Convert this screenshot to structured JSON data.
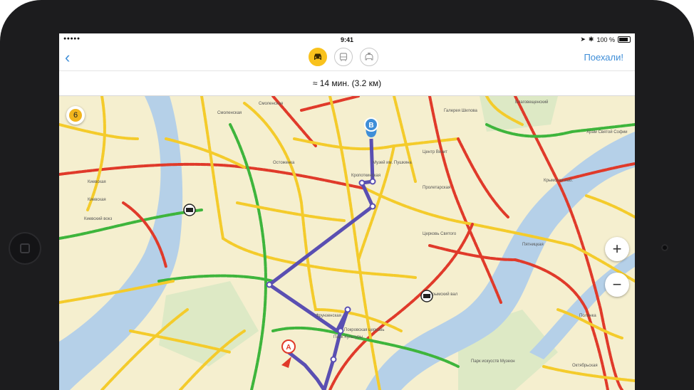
{
  "status_bar": {
    "signal": "●●●●● ",
    "time": "9:41",
    "battery": "100 %"
  },
  "nav": {
    "back": "‹",
    "go_label": "Поехали!"
  },
  "modes": [
    {
      "name": "car",
      "active": true
    },
    {
      "name": "bus",
      "active": false
    },
    {
      "name": "taxi",
      "active": false
    }
  ],
  "route": {
    "eta": "≈ 14 мин. (3.2 км)",
    "start_label": "A",
    "end_label": "B"
  },
  "traffic_level": "6",
  "zoom": {
    "in": "+",
    "out": "−"
  },
  "map_labels": [
    "Киевская",
    "Киевская",
    "Киевский вокз",
    "Смоленская",
    "Смоленская",
    "Музей им. Пушкина",
    "Кропоткинская",
    "Парк Культуры",
    "Фрунзенская",
    "Покровская церковь",
    "Центр Визит",
    "Пролетарская",
    "Храм Святой Софии",
    "Благовещенский",
    "Крымский вал",
    "Парк искусств Музеон",
    "Полянка",
    "Октябрьская",
    "Пятницкая",
    "Церковь Святого",
    "Галерея Шилова",
    "Крымская наб.",
    "Остоженка"
  ],
  "colors": {
    "route": "#5a4fb2",
    "traffic_green": "#3eb53c",
    "traffic_yellow": "#f4cb2b",
    "traffic_red": "#e03a2a",
    "water": "#b5d0e8",
    "accent": "#3f8ed8"
  }
}
